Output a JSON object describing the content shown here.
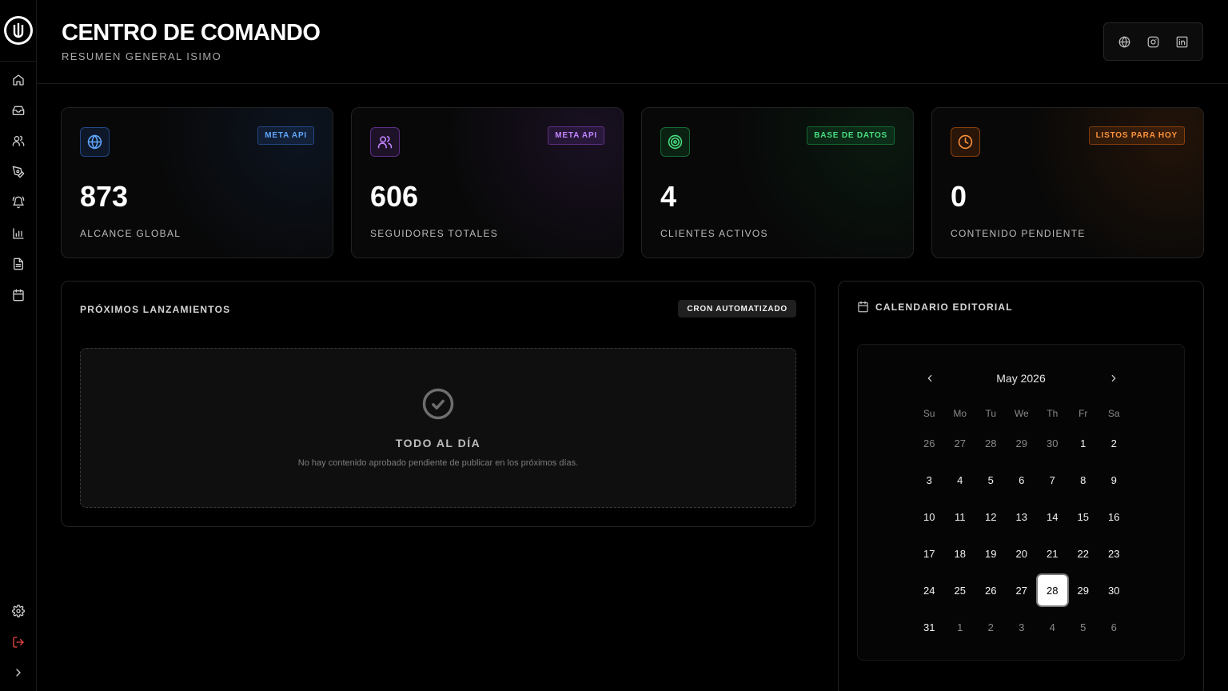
{
  "header": {
    "title": "CENTRO DE COMANDO",
    "subtitle": "RESUMEN GENERAL ISIMO"
  },
  "sidebar": {
    "items": [
      {
        "icon": "home-icon"
      },
      {
        "icon": "inbox-icon"
      },
      {
        "icon": "users-icon"
      },
      {
        "icon": "pen-tool-icon"
      },
      {
        "icon": "bell-ring-icon"
      },
      {
        "icon": "bar-chart-icon"
      },
      {
        "icon": "file-text-icon"
      },
      {
        "icon": "calendar-icon"
      }
    ],
    "bottom": [
      {
        "icon": "settings-icon"
      },
      {
        "icon": "logout-icon"
      },
      {
        "icon": "chevron-right-icon"
      }
    ]
  },
  "social": [
    "globe-icon",
    "instagram-icon",
    "linkedin-icon"
  ],
  "stats": [
    {
      "value": "873",
      "label": "ALCANCE GLOBAL",
      "badge": "META API",
      "color": "#3b82f6",
      "icon": "globe-icon"
    },
    {
      "value": "606",
      "label": "SEGUIDORES TOTALES",
      "badge": "META API",
      "color": "#a855f7",
      "icon": "users-icon"
    },
    {
      "value": "4",
      "label": "CLIENTES ACTIVOS",
      "badge": "BASE DE DATOS",
      "color": "#22c55e",
      "icon": "target-icon"
    },
    {
      "value": "0",
      "label": "CONTENIDO PENDIENTE",
      "badge": "LISTOS PARA HOY",
      "color": "#f97316",
      "icon": "clock-icon"
    }
  ],
  "upcoming": {
    "title": "PRÓXIMOS LANZAMIENTOS",
    "badge": "CRON AUTOMATIZADO",
    "empty_title": "TODO AL DÍA",
    "empty_text": "No hay contenido aprobado pendiente de publicar en los próximos días."
  },
  "calendar": {
    "title": "CALENDARIO EDITORIAL",
    "month": "May 2026",
    "weekdays": [
      "Su",
      "Mo",
      "Tu",
      "We",
      "Th",
      "Fr",
      "Sa"
    ],
    "weeks": [
      [
        {
          "d": "26",
          "m": true
        },
        {
          "d": "27",
          "m": true
        },
        {
          "d": "28",
          "m": true
        },
        {
          "d": "29",
          "m": true
        },
        {
          "d": "30",
          "m": true
        },
        {
          "d": "1"
        },
        {
          "d": "2"
        }
      ],
      [
        {
          "d": "3"
        },
        {
          "d": "4"
        },
        {
          "d": "5"
        },
        {
          "d": "6"
        },
        {
          "d": "7"
        },
        {
          "d": "8"
        },
        {
          "d": "9"
        }
      ],
      [
        {
          "d": "10"
        },
        {
          "d": "11"
        },
        {
          "d": "12"
        },
        {
          "d": "13"
        },
        {
          "d": "14"
        },
        {
          "d": "15"
        },
        {
          "d": "16"
        }
      ],
      [
        {
          "d": "17"
        },
        {
          "d": "18"
        },
        {
          "d": "19"
        },
        {
          "d": "20"
        },
        {
          "d": "21"
        },
        {
          "d": "22"
        },
        {
          "d": "23"
        }
      ],
      [
        {
          "d": "24"
        },
        {
          "d": "25"
        },
        {
          "d": "26"
        },
        {
          "d": "27"
        },
        {
          "d": "28",
          "s": true
        },
        {
          "d": "29"
        },
        {
          "d": "30"
        }
      ],
      [
        {
          "d": "31"
        },
        {
          "d": "1",
          "m": true
        },
        {
          "d": "2",
          "m": true
        },
        {
          "d": "3",
          "m": true
        },
        {
          "d": "4",
          "m": true
        },
        {
          "d": "5",
          "m": true
        },
        {
          "d": "6",
          "m": true
        }
      ]
    ]
  }
}
